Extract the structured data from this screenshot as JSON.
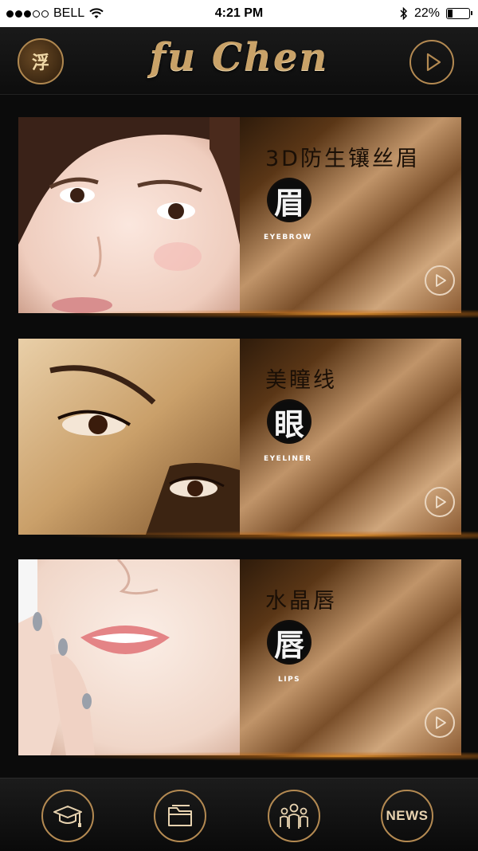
{
  "status_bar": {
    "carrier": "BELL",
    "time": "4:21 PM",
    "battery_percent": "22%",
    "battery_level": 0.22
  },
  "header": {
    "brand": "fu Chen",
    "logo_text": "浮",
    "play_icon": "play-icon"
  },
  "cards": [
    {
      "title": "3D防生镶丝眉",
      "seal": "眉",
      "tag": "EYEBROW"
    },
    {
      "title": "美瞳线",
      "seal": "眼",
      "tag": "EYELINER"
    },
    {
      "title": "水晶唇",
      "seal": "唇",
      "tag": "LIPS"
    }
  ],
  "footer": {
    "items": [
      {
        "icon": "graduation-cap-icon"
      },
      {
        "icon": "folder-icon"
      },
      {
        "icon": "team-icon"
      },
      {
        "label": "NEWS"
      }
    ]
  },
  "colors": {
    "gold": "#b48a52",
    "brand_gold": "#c9a268",
    "background": "#0b0b0b"
  }
}
